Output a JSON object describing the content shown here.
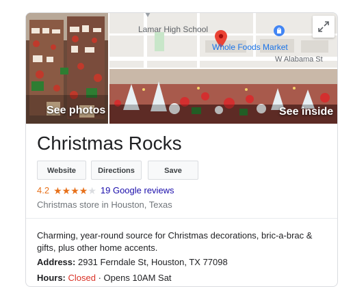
{
  "colors": {
    "rating_orange": "#e7711b",
    "link_blue": "#1a0dab",
    "closed_red": "#d93025",
    "map_pin_red": "#ea4335",
    "poi_blue": "#4285f4",
    "star_empty": "#dadce0"
  },
  "photos": {
    "see_photos_label": "See photos",
    "see_inside_label": "See inside"
  },
  "map": {
    "school_label": "Lamar High School",
    "store_label": "Whole Foods Market",
    "street_label": "W Alabama St",
    "expand_icon": "expand-icon"
  },
  "place": {
    "name": "Christmas Rocks",
    "rating": "4.2",
    "rating_value": 4.2,
    "rating_max": 5,
    "reviews_label": "19 Google reviews",
    "category": "Christmas store in Houston, Texas",
    "description": "Charming, year-round source for Christmas decorations, bric-a-brac & gifts, plus other home accents.",
    "address_label": "Address:",
    "address": "2931 Ferndale St, Houston, TX 77098",
    "hours_label": "Hours:",
    "hours_status": "Closed",
    "hours_detail": "· Opens 10AM Sat"
  },
  "actions": {
    "website_label": "Website",
    "directions_label": "Directions",
    "save_label": "Save"
  }
}
